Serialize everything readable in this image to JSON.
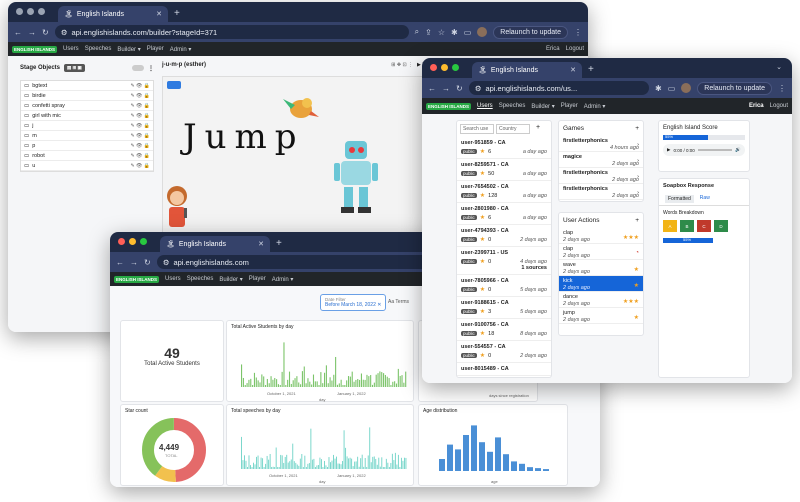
{
  "window_builder": {
    "tab_title": "English Islands",
    "url": "api.englishislands.com/builder?stageId=371",
    "relaunch": "Relaunch to update",
    "nav": {
      "logo": "ENGLISH ISLANDS",
      "items": [
        "Users",
        "Speeches",
        "Builder ▾",
        "Player",
        "Admin ▾"
      ],
      "user": "Erica",
      "logout": "Logout"
    },
    "panel_title": "Stage Objects",
    "stage_title": "j-u-m-p (esther)",
    "play_label": "▶ Play",
    "objects": [
      {
        "name": "bgtext"
      },
      {
        "name": "birdie"
      },
      {
        "name": "confetti spray"
      },
      {
        "name": "girl with mic"
      },
      {
        "name": "j"
      },
      {
        "name": "m"
      },
      {
        "name": "p"
      },
      {
        "name": "robot"
      },
      {
        "name": "u"
      }
    ],
    "stage_word": "Jump"
  },
  "window_dashboard": {
    "tab_title": "English Islands",
    "url": "api.englishislands.com",
    "nav": {
      "logo": "ENGLISH ISLANDS",
      "items": [
        "Users",
        "Speeches",
        "Builder ▾",
        "Player",
        "Admin ▾"
      ]
    },
    "date_filter_label": "Date Filter",
    "date_filter_value": "Before March 18, 2022",
    "terms_label": "Aa  Terms",
    "total_active_value": "49",
    "total_active_label": "Total Active Students",
    "star_count_label": "Star count",
    "star_count_total": "4,449",
    "star_count_sub": "TOTAL",
    "chart1_title": "Total Active Students by day",
    "chart1_x1": "October 1, 2021",
    "chart1_x2": "January 1, 2022",
    "chart1_xlabel": "day",
    "chart1_right_label": "days since registration",
    "chart2_title": "Total speeches by day",
    "chart2_x1": "October 1, 2021",
    "chart2_x2": "January 1, 2022",
    "chart2_xlabel": "day",
    "chart3_title": "Age distribution",
    "chart3_xlabel": "age"
  },
  "window_users": {
    "tab_title": "English Islands",
    "url": "api.englishislands.com/us...",
    "relaunch": "Relaunch to update",
    "nav": {
      "logo": "ENGLISH ISLANDS",
      "items": [
        "Users",
        "Speeches",
        "Builder ▾",
        "Player",
        "Admin ▾"
      ],
      "user": "Erica",
      "logout": "Logout"
    },
    "search_placeholder": "Search use",
    "country_placeholder": "Country",
    "users": [
      {
        "id": "user-951859 - CA",
        "stars": "6",
        "when": "a day ago"
      },
      {
        "id": "user-8259571 - CA",
        "stars": "50",
        "when": "a day ago"
      },
      {
        "id": "user-7654502 - CA",
        "stars": "128",
        "when": "a day ago"
      },
      {
        "id": "user-2801980 - CA",
        "stars": "6",
        "when": "a day ago"
      },
      {
        "id": "user-4794393 - CA",
        "stars": "0",
        "when": "2 days ago"
      },
      {
        "id": "user-2399711 - US",
        "stars": "0",
        "when": "4 days ago",
        "extra": "1 sources"
      },
      {
        "id": "user-7805966 - CA",
        "stars": "0",
        "when": "5 days ago"
      },
      {
        "id": "user-9188615 - CA",
        "stars": "3",
        "when": "5 days ago"
      },
      {
        "id": "user-9100756 - CA",
        "stars": "18",
        "when": "8 days ago"
      },
      {
        "id": "user-554557 - CA",
        "stars": "0",
        "when": "2 days ago"
      },
      {
        "id": "user-8015489 - CA",
        "stars": "",
        "when": ""
      }
    ],
    "pill_label": "public",
    "games_title": "Games",
    "games": [
      {
        "name": "firstletterphonics",
        "when": "4 hours ago"
      },
      {
        "name": "magice",
        "when": "2 days ago"
      },
      {
        "name": "firstletterphonics",
        "when": "2 days ago"
      },
      {
        "name": "firstletterphonics",
        "when": "2 days ago"
      }
    ],
    "actions_title": "User Actions",
    "actions": [
      {
        "name": "clap",
        "when": "2 days ago",
        "icon": "★★★"
      },
      {
        "name": "clap",
        "when": "2 days ago",
        "icon": "◔"
      },
      {
        "name": "wave",
        "when": "2 days ago",
        "icon": "★"
      },
      {
        "name": "kick",
        "when": "2 days ago",
        "icon": "★",
        "selected": true
      },
      {
        "name": "dance",
        "when": "2 days ago",
        "icon": "★★★"
      },
      {
        "name": "jump",
        "when": "2 days ago",
        "icon": "★"
      }
    ],
    "score_title": "English Island Score",
    "score_percent": "55%",
    "score_fraction": 0.55,
    "audio_time": "0:00 / 0:00",
    "soapbox_title": "Soapbox Response",
    "tab_formatted": "Formatted",
    "tab_raw": "Raw",
    "words_title": "Words Breakdown",
    "words": [
      "A",
      "B",
      "C",
      "D"
    ],
    "words_percent": "55%"
  },
  "colors": {
    "chrome_dark": "#1f2a44",
    "chrome_mid": "#35426a",
    "app_nav": "#212529",
    "accent_blue": "#1565d8",
    "green_bars": "#7cc46a",
    "teal_bars": "#6fd3c7",
    "age_bars": "#4a8fd6"
  }
}
